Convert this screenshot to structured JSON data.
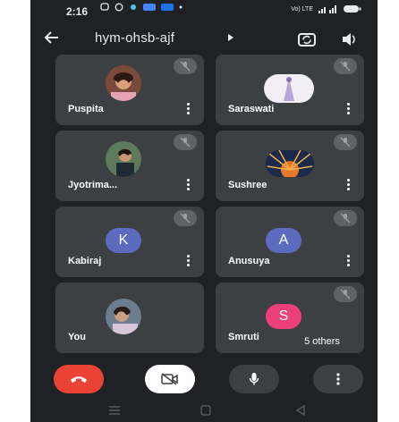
{
  "status_bar": {
    "time": "2:16",
    "network": "Vo) LTE"
  },
  "meeting": {
    "code": "hym-ohsb-ajf"
  },
  "participants": [
    {
      "name": "Puspita",
      "avatar_type": "photo"
    },
    {
      "name": "Saraswati",
      "avatar_type": "photo"
    },
    {
      "name": "Jyotrima...",
      "avatar_type": "photo"
    },
    {
      "name": "Sushree",
      "avatar_type": "photo"
    },
    {
      "name": "Kabiraj",
      "avatar_type": "letter",
      "letter": "K",
      "color": "#5c6bc0"
    },
    {
      "name": "Anusuya",
      "avatar_type": "letter",
      "letter": "A",
      "color": "#5c6bc0"
    },
    {
      "name": "You",
      "avatar_type": "photo"
    },
    {
      "name": "Smruti",
      "avatar_type": "letter",
      "letter": "S",
      "color": "#ec407a"
    }
  ],
  "others_chip": {
    "label": "5 others"
  },
  "controls": {
    "end_call_color": "#ea4335",
    "camera_off_bg": "#ffffff",
    "dark_bg": "#3c4043"
  },
  "icons": [
    "back-arrow-icon",
    "dropdown-chevron-icon",
    "switch-camera-icon",
    "speaker-icon",
    "mic-off-icon",
    "more-vert-icon",
    "end-call-icon",
    "camera-off-icon",
    "mic-icon"
  ]
}
